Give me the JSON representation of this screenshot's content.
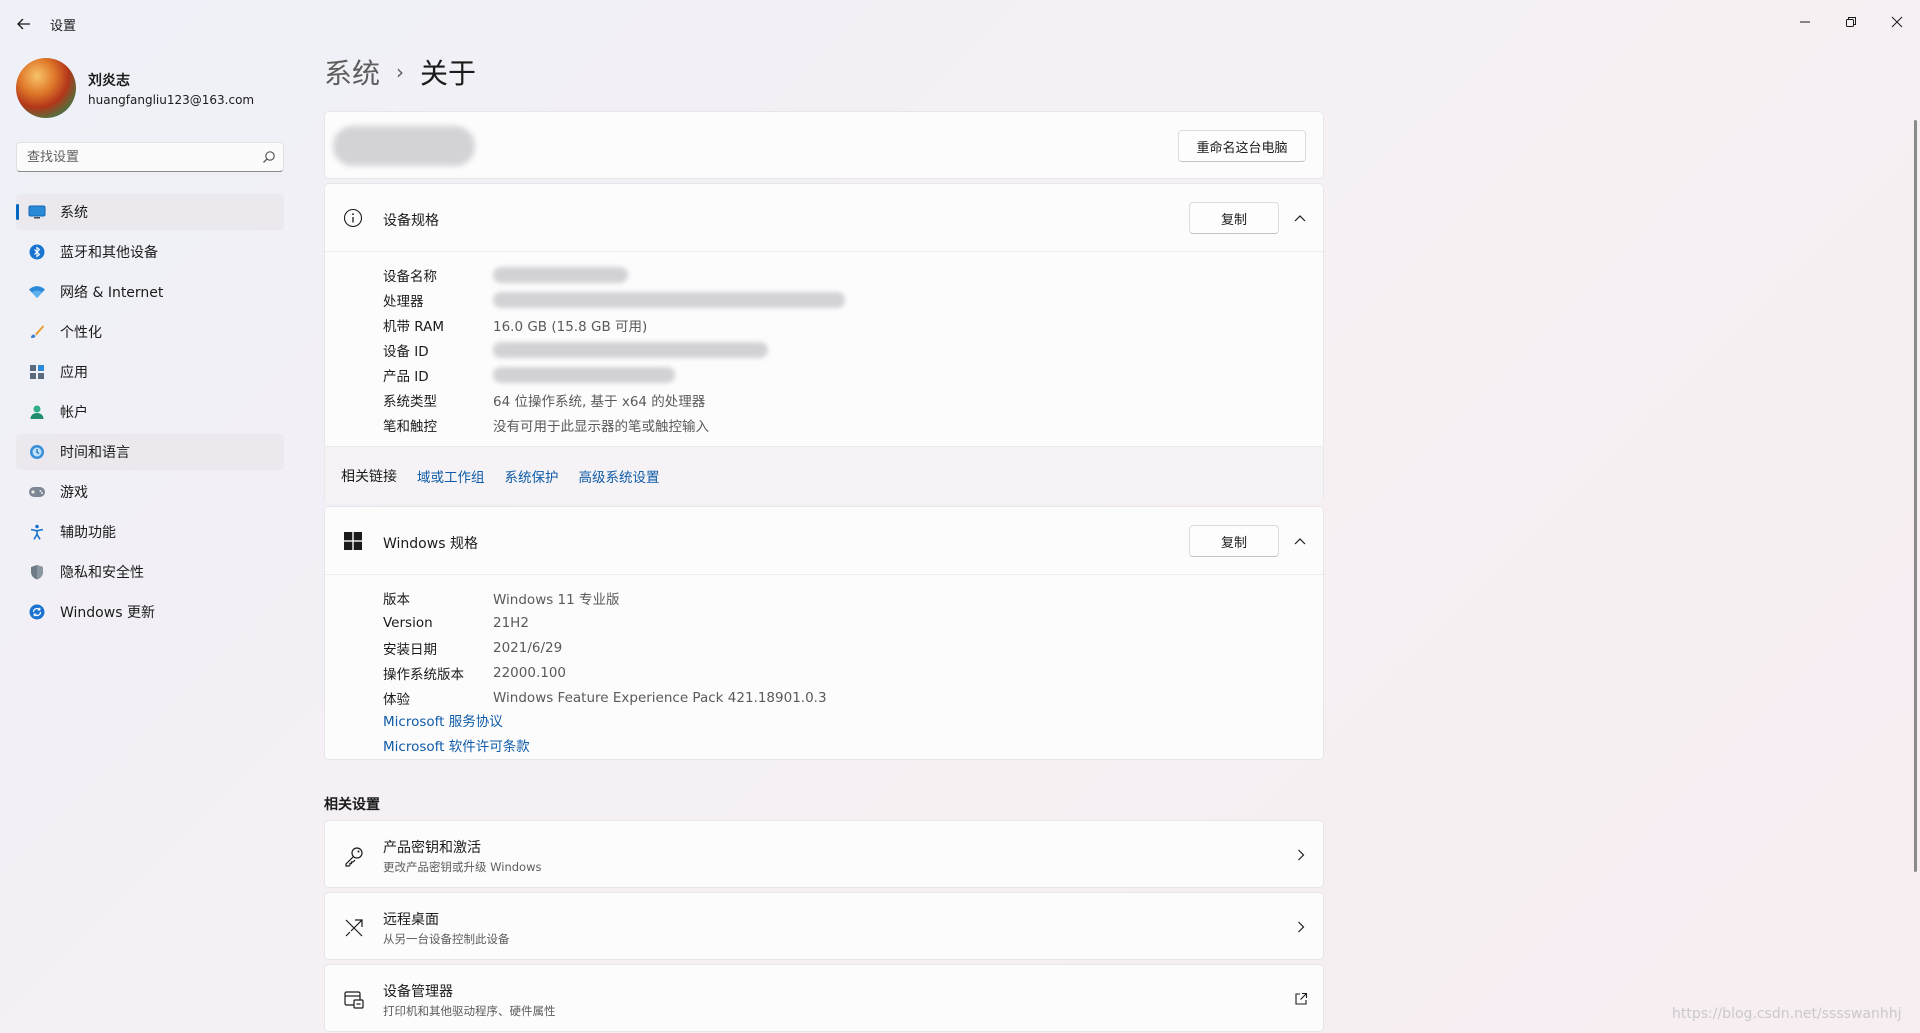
{
  "window": {
    "app_title": "设置",
    "minimize_glyph": "—",
    "restore_glyph": "❐",
    "close_glyph": "✕"
  },
  "profile": {
    "name": "刘炎志",
    "email": "huangfangliu123@163.com"
  },
  "search": {
    "placeholder": "查找设置"
  },
  "nav": {
    "items": [
      {
        "label": "系统",
        "icon": "display-icon",
        "active": true
      },
      {
        "label": "蓝牙和其他设备",
        "icon": "bluetooth-icon"
      },
      {
        "label": "网络 & Internet",
        "icon": "wifi-icon"
      },
      {
        "label": "个性化",
        "icon": "brush-icon"
      },
      {
        "label": "应用",
        "icon": "apps-icon"
      },
      {
        "label": "帐户",
        "icon": "account-icon"
      },
      {
        "label": "时间和语言",
        "icon": "time-language-icon"
      },
      {
        "label": "游戏",
        "icon": "gamepad-icon"
      },
      {
        "label": "辅助功能",
        "icon": "accessibility-icon"
      },
      {
        "label": "隐私和安全性",
        "icon": "shield-icon"
      },
      {
        "label": "Windows 更新",
        "icon": "update-icon"
      }
    ]
  },
  "breadcrumb": {
    "parent": "系统",
    "separator": "›",
    "current": "关于"
  },
  "rename": {
    "button_label": "重命名这台电脑"
  },
  "device_specs": {
    "title": "设备规格",
    "copy_label": "复制",
    "rows": [
      {
        "label": "设备名称",
        "value": ""
      },
      {
        "label": "处理器",
        "value": ""
      },
      {
        "label": "机带 RAM",
        "value": "16.0 GB (15.8 GB 可用)"
      },
      {
        "label": "设备 ID",
        "value": ""
      },
      {
        "label": "产品 ID",
        "value": ""
      },
      {
        "label": "系统类型",
        "value": "64 位操作系统, 基于 x64 的处理器"
      },
      {
        "label": "笔和触控",
        "value": "没有可用于此显示器的笔或触控输入"
      }
    ]
  },
  "related_links": {
    "label": "相关链接",
    "links": [
      "域或工作组",
      "系统保护",
      "高级系统设置"
    ]
  },
  "windows_specs": {
    "title": "Windows 规格",
    "copy_label": "复制",
    "rows": [
      {
        "label": "版本",
        "value": "Windows 11 专业版"
      },
      {
        "label": "Version",
        "value": "21H2"
      },
      {
        "label": "安装日期",
        "value": "2021/6/29"
      },
      {
        "label": "操作系统版本",
        "value": "22000.100"
      },
      {
        "label": "体验",
        "value": "Windows Feature Experience Pack 421.18901.0.3"
      }
    ],
    "links": [
      "Microsoft 服务协议",
      "Microsoft 软件许可条款"
    ]
  },
  "related_settings": {
    "title": "相关设置",
    "items": [
      {
        "title": "产品密钥和激活",
        "subtitle": "更改产品密钥或升级 Windows",
        "icon": "key-icon",
        "action": "chevron-right-icon"
      },
      {
        "title": "远程桌面",
        "subtitle": "从另一台设备控制此设备",
        "icon": "remote-desktop-icon",
        "action": "chevron-right-icon"
      },
      {
        "title": "设备管理器",
        "subtitle": "打印机和其他驱动程序、硬件属性",
        "icon": "device-manager-icon",
        "action": "external-link-icon"
      }
    ]
  },
  "watermark": "https://blog.csdn.net/sssswanhhj",
  "colors": {
    "accent": "#0067c0",
    "link": "#0f5ba8"
  }
}
